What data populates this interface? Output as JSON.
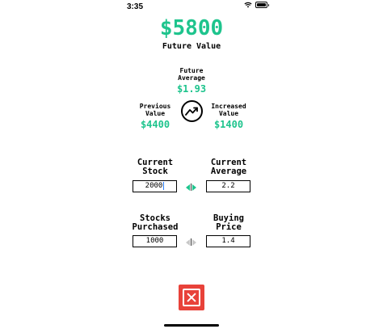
{
  "status": {
    "time": "3:35"
  },
  "summary": {
    "future_value": "$5800",
    "future_value_label": "Future Value",
    "future_average_label": "Future\nAverage",
    "future_average": "$1.93",
    "previous_value_label": "Previous\nValue",
    "previous_value": "$4400",
    "increased_value_label": "Increased\nValue",
    "increased_value": "$1400"
  },
  "inputs": {
    "current_stock_label": "Current\nStock",
    "current_stock": "2000",
    "current_average_label": "Current\nAverage",
    "current_average": "2.2",
    "stocks_purchased_label": "Stocks\nPurchased",
    "stocks_purchased": "1000",
    "buying_price_label": "Buying\nPrice",
    "buying_price": "1.4"
  },
  "colors": {
    "accent": "#1ec48d",
    "close": "#e8423a"
  },
  "icons": {
    "trend": "trending-up-icon",
    "close": "close-icon"
  }
}
